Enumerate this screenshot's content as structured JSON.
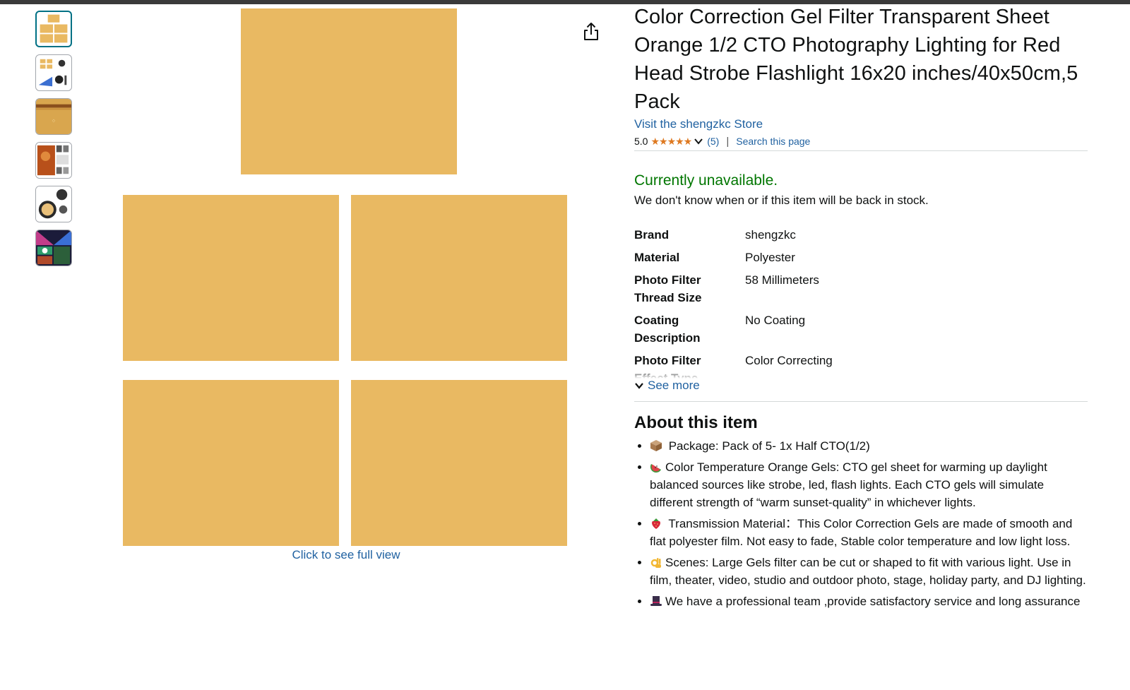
{
  "product": {
    "title": "Color Correction Gel Filter Transparent Sheet Orange 1/2 CTO Photography Lighting for Red Head Strobe Flashlight 16x20 inches/40x50cm,5 Pack",
    "store_link": "Visit the shengzkc Store",
    "rating": "5.0",
    "stars": "★★★★★",
    "rating_count": "(5)",
    "search_page": "Search this page",
    "separator": "|"
  },
  "availability": {
    "status": "Currently unavailable.",
    "note": "We don't know when or if this item will be back in stock."
  },
  "specs": [
    {
      "key": "Brand",
      "value": "shengzkc"
    },
    {
      "key": "Material",
      "value": "Polyester"
    },
    {
      "key": "Photo Filter Thread Size",
      "value": "58 Millimeters"
    },
    {
      "key": "Coating Description",
      "value": "No Coating"
    },
    {
      "key": "Photo Filter Effect Type",
      "value": "Color Correcting"
    }
  ],
  "see_more": "See more",
  "about": {
    "title": "About this item",
    "bullets": [
      {
        "icon": "package-emoji",
        "text": " Package: Pack of 5- 1x Half CTO(1/2)"
      },
      {
        "icon": "watermelon-emoji",
        "text": "Color Temperature Orange Gels: CTO gel sheet for warming up daylight balanced sources like strobe, led, flash lights. Each CTO gels will simulate different strength of “warm sunset-quality” in whichever lights."
      },
      {
        "icon": "strawberry-emoji",
        "text": " Transmission Material：This Color Correction Gels are made of smooth and flat polyester film. Not easy to fade, Stable color temperature and low light loss."
      },
      {
        "icon": "ok-hand-emoji",
        "text": "Scenes: Large Gels filter can be cut or shaped to fit with various light. Use in film, theater, video, studio and outdoor photo, stage, holiday party, and DJ lighting."
      },
      {
        "icon": "top-hat-emoji",
        "text": "We have a professional team ,provide satisfactory service and long assurance"
      }
    ]
  },
  "image": {
    "see_full": "Click to see full view",
    "sheet_color": "#e9b962"
  },
  "thumbnails": [
    {
      "name": "thumbnail-gel-sheets"
    },
    {
      "name": "thumbnail-lighting-setup"
    },
    {
      "name": "thumbnail-gel-roll"
    },
    {
      "name": "thumbnail-warm-portrait"
    },
    {
      "name": "thumbnail-round-gel"
    },
    {
      "name": "thumbnail-stage-lighting"
    }
  ],
  "colors": {
    "link": "#2162a1",
    "available": "#007600",
    "star": "#de7921"
  }
}
